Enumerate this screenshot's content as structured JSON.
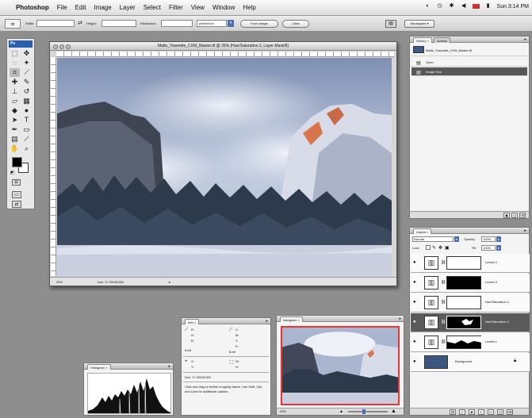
{
  "menubar": {
    "app_name": "Photoshop",
    "items": [
      "File",
      "Edit",
      "Image",
      "Layer",
      "Select",
      "Filter",
      "View",
      "Window",
      "Help"
    ],
    "clock": "Sun 3:14 PM"
  },
  "options": {
    "width_label": "Width:",
    "height_label": "Height:",
    "resolution_label": "Resolution:",
    "resolution_unit": "pixels/inch",
    "front_image_label": "Front Image",
    "clear_label": "Clear",
    "workspace_label": "Workspace ▾"
  },
  "document": {
    "title": "Matts_Yosemite_CXM_Master.tif @ 25% (Hue/Saturation 2, Layer Mask/8)",
    "zoom": "25%",
    "doc_size": "Doc: 17.2M/33.6M"
  },
  "history": {
    "tabs": [
      "History ×",
      "Actions"
    ],
    "snapshot_name": "Matts_Yosemite_CXM_Master.tif",
    "items": [
      "Open",
      "Image Size"
    ],
    "active_index": 1
  },
  "layers": {
    "tabs": [
      "Layers ×"
    ],
    "blend_mode": "Normal",
    "opacity_label": "Opacity:",
    "opacity_value": "100%",
    "lock_label": "Lock:",
    "fill_label": "Fill:",
    "fill_value": "100%",
    "rows": [
      {
        "name": "Levels 2",
        "mask": "white"
      },
      {
        "name": "Levels 3",
        "mask": "black"
      },
      {
        "name": "Hue/Saturation 1",
        "mask": "white"
      },
      {
        "name": "Hue/Saturation 2",
        "mask": "black",
        "active": true
      },
      {
        "name": "Levels 1",
        "mask": "black"
      },
      {
        "name": "Background",
        "mask": "image"
      }
    ]
  },
  "info": {
    "tab": "Info ×",
    "rgb": [
      "R:",
      "G:",
      "B:"
    ],
    "cmyk": [
      "C:",
      "M:",
      "Y:",
      "K:"
    ],
    "bit_left": "8-bit",
    "bit_right": "8-bit",
    "xy": [
      "X:",
      "Y:"
    ],
    "wh": [
      "W:",
      "H:"
    ],
    "doc": "Doc: 17.2M/33.6M",
    "hint": "Click and drag to define cropping frame. Use Shift, Opt, and Cmd for additional options."
  },
  "navigator": {
    "tab": "Navigator ×",
    "zoom": "25%"
  },
  "histogram": {
    "tab": "Histogram ×"
  },
  "colors": {
    "accent_blue": "#2a5fb0",
    "nav_frame": "#e33333",
    "active_row": "#575757"
  }
}
